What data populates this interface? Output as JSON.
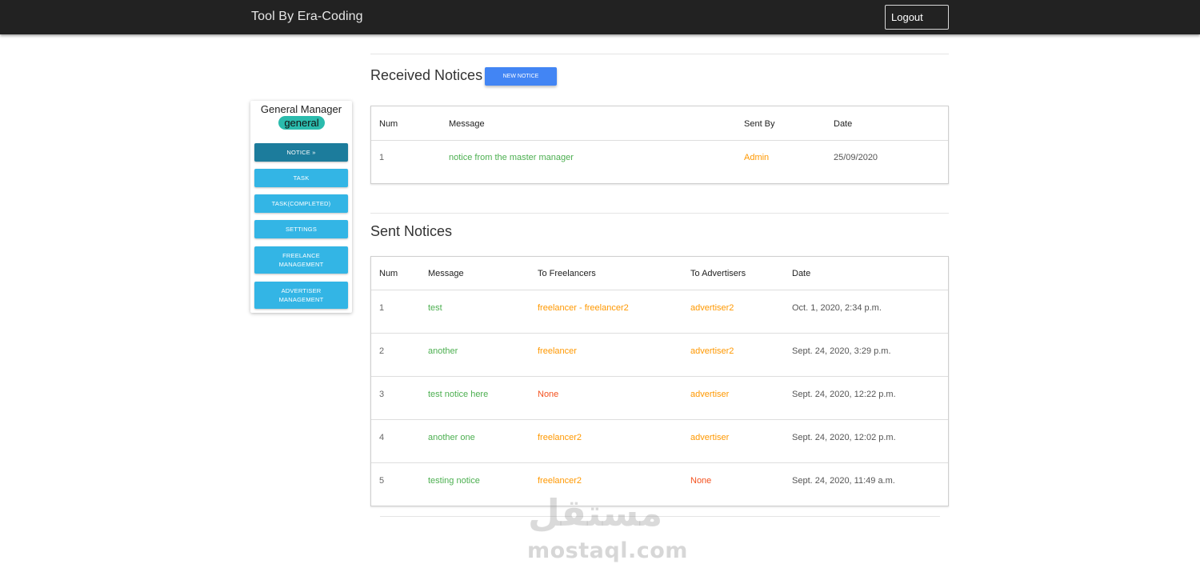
{
  "navbar": {
    "brand": "Tool By Era-Coding",
    "logout_label": "Logout"
  },
  "sidebar": {
    "title": "General Manager",
    "badge": "general",
    "items": [
      {
        "label": "NOTICE »",
        "active": true
      },
      {
        "label": "TASK"
      },
      {
        "label": "TASK(COMPLETED)"
      },
      {
        "label": "SETTINGS"
      },
      {
        "label": "FREELANCE MANAGEMENT"
      },
      {
        "label": "ADVERTISER MANAGEMENT"
      }
    ]
  },
  "received": {
    "title": "Received Notices",
    "new_notice_label": "NEW NOTICE",
    "headers": [
      "Num",
      "Message",
      "Sent By",
      "Date"
    ],
    "rows": [
      {
        "num": "1",
        "message": "notice from the master manager",
        "sent_by": "Admin",
        "date": "25/09/2020"
      }
    ]
  },
  "sent": {
    "title": "Sent Notices",
    "headers": [
      "Num",
      "Message",
      "To Freelancers",
      "To Advertisers",
      "Date"
    ],
    "rows": [
      {
        "num": "1",
        "message": "test",
        "to_freelancers": "freelancer - freelancer2",
        "to_advertisers": "advertiser2",
        "date": "Oct. 1, 2020, 2:34 p.m."
      },
      {
        "num": "2",
        "message": "another",
        "to_freelancers": "freelancer",
        "to_advertisers": "advertiser2",
        "date": "Sept. 24, 2020, 3:29 p.m."
      },
      {
        "num": "3",
        "message": "test notice here",
        "to_freelancers": "None",
        "to_advertisers": "advertiser",
        "date": "Sept. 24, 2020, 12:22 p.m."
      },
      {
        "num": "4",
        "message": "another one",
        "to_freelancers": "freelancer2",
        "to_advertisers": "advertiser",
        "date": "Sept. 24, 2020, 12:02 p.m."
      },
      {
        "num": "5",
        "message": "testing notice",
        "to_freelancers": "freelancer2",
        "to_advertisers": "None",
        "date": "Sept. 24, 2020, 11:49 a.m."
      }
    ]
  },
  "watermark": {
    "arabic": "مستقل",
    "latin": "mostaql.com"
  },
  "colors": {
    "navbar": "#222222",
    "active_button": "#1c7c9c",
    "button": "#33b5e5",
    "badge": "#2bbbad",
    "new_notice": "#4285f4",
    "message_text": "#4caf50",
    "recipient_text": "#ff9800",
    "none_text": "#f4511e"
  }
}
